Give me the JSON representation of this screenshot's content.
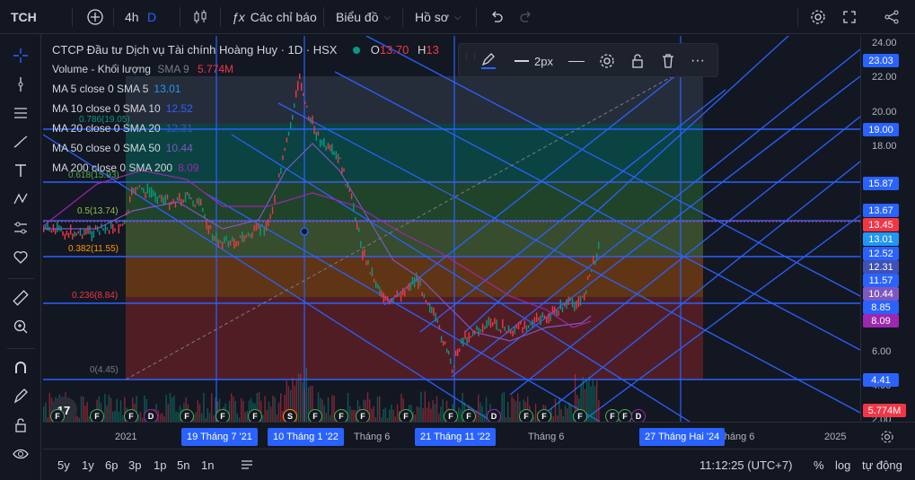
{
  "topbar": {
    "symbol": "TCH",
    "interval": "4h",
    "interval_alt": "D",
    "indicators_label": "Các chỉ báo",
    "chart_type_label": "Biểu đồ",
    "layout_label": "Hồ sơ"
  },
  "legend": {
    "title": "CTCP Đầu tư Dịch vụ Tài chính Hoàng Huy · 1D · HSX",
    "ohlc_o_label": "O",
    "ohlc_o_value": "13.70",
    "ohlc_h_label": "H",
    "ohlc_h_value": "13",
    "volume_label": "Volume - Khối lượng",
    "volume_sma": "SMA 9",
    "volume_value": "5.774M",
    "ma_rows": [
      {
        "label": "MA 5 close 0 SMA 5",
        "value": "13.01",
        "color": "#2196f3"
      },
      {
        "label": "MA 10 close 0 SMA 10",
        "value": "12.52",
        "color": "#2962ff"
      },
      {
        "label": "MA 20 close 0 SMA 20",
        "value": "12.31",
        "color": "#3f51b5"
      },
      {
        "label": "MA 50 close 0 SMA 50",
        "value": "10.44",
        "color": "#7e57c2"
      },
      {
        "label": "MA 200 close 0 SMA 200",
        "value": "8.09",
        "color": "#9c27b0"
      }
    ]
  },
  "draw_toolbar": {
    "width_label": "2px"
  },
  "fib_labels": [
    {
      "text": "0.786(19.05)",
      "color": "#089981"
    },
    {
      "text": "0.618(15.93)",
      "color": "#4caf50"
    },
    {
      "text": "0.5(13.74)",
      "color": "#8bc34a"
    },
    {
      "text": "0.382(11.55)",
      "color": "#ff9800"
    },
    {
      "text": "0.236(8.84)",
      "color": "#f23645"
    },
    {
      "text": "0(4.45)",
      "color": "#787b86"
    }
  ],
  "price_scale": {
    "ticks": [
      "24.00",
      "22.00",
      "20.00",
      "18.00",
      "6.00",
      "4.00",
      "2.00"
    ],
    "badges": [
      {
        "text": "23.03",
        "bg": "#2962ff"
      },
      {
        "text": "19.00",
        "bg": "#2962ff"
      },
      {
        "text": "15.87",
        "bg": "#2962ff"
      },
      {
        "text": "13.67",
        "bg": "#2962ff"
      },
      {
        "text": "13.45",
        "bg": "#f23645"
      },
      {
        "text": "13.01",
        "bg": "#2196f3"
      },
      {
        "text": "12.52",
        "bg": "#2962ff"
      },
      {
        "text": "12.31",
        "bg": "#3f51b5"
      },
      {
        "text": "11.57",
        "bg": "#2962ff"
      },
      {
        "text": "10.44",
        "bg": "#7e57c2"
      },
      {
        "text": "8.85",
        "bg": "#2962ff"
      },
      {
        "text": "8.09",
        "bg": "#9c27b0"
      },
      {
        "text": "4.41",
        "bg": "#2962ff"
      },
      {
        "text": "5.774M",
        "bg": "#f23645"
      }
    ]
  },
  "time_scale": {
    "labels": [
      "2021",
      "Tháng 6",
      "Tháng 6",
      "Tháng 6",
      "2025"
    ],
    "badges": [
      "19 Tháng 7 '21",
      "10 Tháng 1 '22",
      "21 Tháng 11 '22",
      "27 Tháng Hai '24"
    ]
  },
  "bottombar": {
    "ranges": [
      "5y",
      "1y",
      "6p",
      "3p",
      "1p",
      "5n",
      "1n"
    ],
    "clock": "11:12:25 (UTC+7)",
    "percent": "%",
    "log": "log",
    "auto": "tự động"
  },
  "events": [
    "F",
    "F",
    "F",
    "D",
    "F",
    "F",
    "F",
    "S",
    "F",
    "F",
    "F",
    "F",
    "F",
    "F",
    "D",
    "F",
    "F",
    "F",
    "F",
    "F",
    "D"
  ],
  "colors": {
    "accent": "#2962ff",
    "up": "#089981",
    "down": "#f23645",
    "bg": "#131722"
  }
}
